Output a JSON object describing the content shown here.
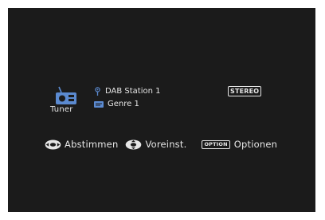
{
  "source": {
    "label": "Tuner",
    "icon": "radio-icon"
  },
  "station": {
    "name": "DAB Station 1",
    "icon": "antenna-icon"
  },
  "genre": {
    "name": "Genre 1",
    "icon": "pty-icon"
  },
  "stereo_badge": "STEREO",
  "actions": {
    "tune": {
      "label": "Abstimmen",
      "icon": "cursor-left-right-icon"
    },
    "preset": {
      "label": "Voreinst.",
      "icon": "cursor-up-down-icon"
    },
    "option": {
      "badge": "OPTION",
      "label": "Optionen"
    }
  },
  "colors": {
    "background": "#1b1b1b",
    "foreground": "#e6e6e6",
    "accent": "#5b8ad0"
  }
}
